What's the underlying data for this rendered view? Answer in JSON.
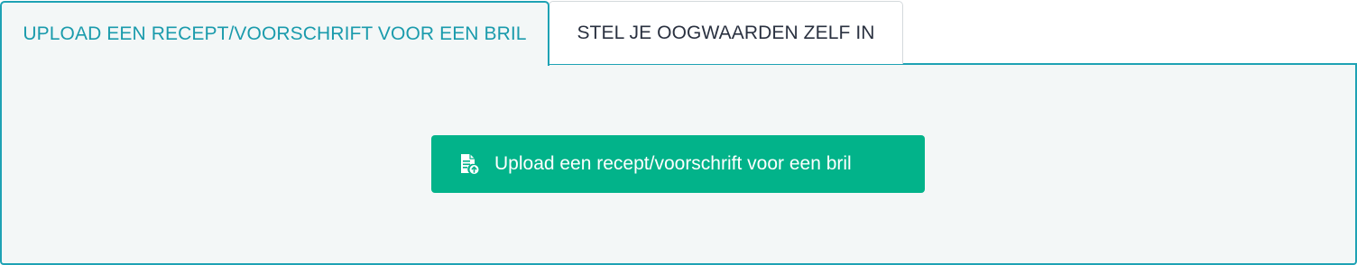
{
  "tabs": [
    {
      "label": "UPLOAD EEN RECEPT/VOORSCHRIFT VOOR EEN BRIL",
      "active": true
    },
    {
      "label": "STEL JE OOGWAARDEN ZELF IN",
      "active": false
    }
  ],
  "panel": {
    "upload_button": {
      "label": "Upload een recept/voorschrift voor een bril",
      "icon": "file-upload-icon"
    }
  },
  "colors": {
    "accent": "#1ea2b4",
    "active_tab_text": "#1a9bac",
    "panel_bg": "#f3f7f7",
    "button_bg": "#02b38a",
    "button_text": "#ffffff",
    "inactive_tab_text": "#2a3140"
  }
}
